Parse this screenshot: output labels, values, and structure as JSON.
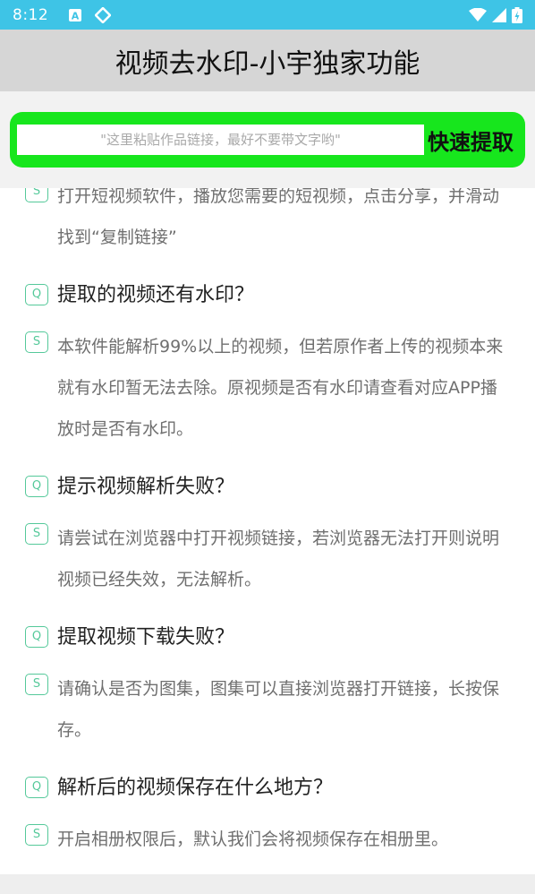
{
  "status_bar": {
    "time": "8:12",
    "left_icons": [
      "a-notification-icon",
      "diamond-icon"
    ],
    "right_icons": [
      "wifi-icon",
      "signal-icon",
      "battery-icon"
    ]
  },
  "title": "视频去水印-小宇独家功能",
  "search": {
    "placeholder": "\"这里粘贴作品链接，最好不要带文字哟\"",
    "button_label": "快速提取"
  },
  "faq": [
    {
      "answer": "打开短视频软件，播放您需要的短视频，点击分享，并滑动找到“复制链接”"
    },
    {
      "question": "提取的视频还有水印？",
      "answer": "本软件能解析99%以上的视频，但若原作者上传的视频本来就有水印暂无法去除。原视频是否有水印请查看对应APP播放时是否有水印。"
    },
    {
      "question": "提示视频解析失败？",
      "answer": "请尝试在浏览器中打开视频链接，若浏览器无法打开则说明视频已经失效，无法解析。"
    },
    {
      "question": "提取视频下载失败？",
      "answer": "请确认是否为图集，图集可以直接浏览器打开链接，长按保存。"
    },
    {
      "question": "解析后的视频保存在什么地方？",
      "answer": "开启相册权限后，默认我们会将视频保存在相册里。"
    }
  ],
  "badges": {
    "question": "Q",
    "answer": "S"
  },
  "colors": {
    "status_bar": "#3ec4e6",
    "title_bar": "#d6d6d6",
    "search_bg": "#17e61d",
    "badge": "#55c99a"
  }
}
